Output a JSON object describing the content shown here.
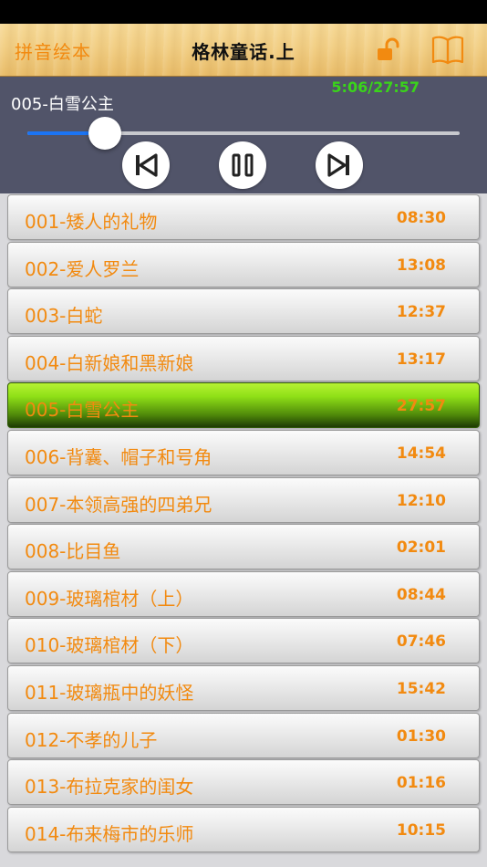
{
  "header": {
    "left_label": "拼音绘本",
    "title": "格林童话.上"
  },
  "player": {
    "current_track": "005-白雪公主",
    "time_readout": "5:06/27:57",
    "progress": 0.18
  },
  "colors": {
    "accent_orange": "#f28a10",
    "time_green": "#3ad41a",
    "active_row_green": "#8fe017",
    "slider_blue": "#1b74f4",
    "player_bg": "#515469"
  },
  "tracks": [
    {
      "title": "001-矮人的礼物",
      "duration": "08:30"
    },
    {
      "title": "002-爱人罗兰",
      "duration": "13:08"
    },
    {
      "title": "003-白蛇",
      "duration": "12:37"
    },
    {
      "title": "004-白新娘和黑新娘",
      "duration": "13:17"
    },
    {
      "title": "005-白雪公主",
      "duration": "27:57"
    },
    {
      "title": "006-背囊、帽子和号角",
      "duration": "14:54"
    },
    {
      "title": "007-本领高强的四弟兄",
      "duration": "12:10"
    },
    {
      "title": "008-比目鱼",
      "duration": "02:01"
    },
    {
      "title": "009-玻璃棺材（上）",
      "duration": "08:44"
    },
    {
      "title": "010-玻璃棺材（下）",
      "duration": "07:46"
    },
    {
      "title": "011-玻璃瓶中的妖怪",
      "duration": "15:42"
    },
    {
      "title": "012-不孝的儿子",
      "duration": "01:30"
    },
    {
      "title": "013-布拉克家的闺女",
      "duration": "01:16"
    },
    {
      "title": "014-布来梅市的乐师",
      "duration": "10:15"
    }
  ],
  "active_index": 4
}
